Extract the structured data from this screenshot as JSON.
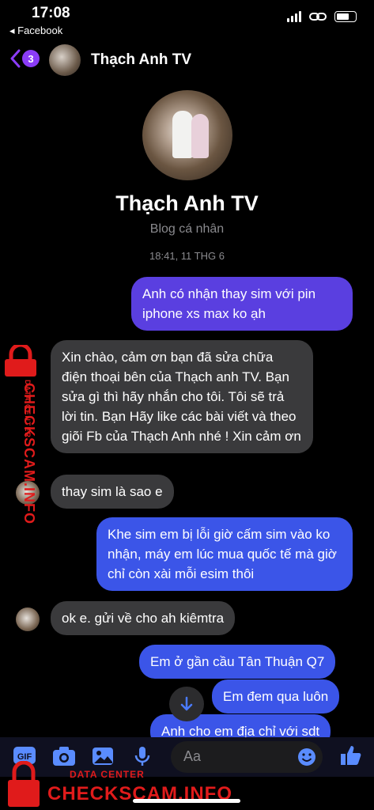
{
  "status": {
    "time": "17:08",
    "back_app": "◂ Facebook"
  },
  "header": {
    "badge": "3",
    "name": "Thạch Anh TV"
  },
  "profile": {
    "name": "Thạch Anh TV",
    "subtitle": "Blog cá nhân",
    "timestamp": "18:41, 11 THG 6"
  },
  "messages": [
    {
      "side": "out",
      "text": "Anh có nhận thay sim với pin iphone xs max ko ạh"
    },
    {
      "side": "in",
      "text": "Xin chào, cảm ơn bạn đã sửa chữa điện thoại bên của Thạch anh TV. Bạn sửa gì thì hãy nhắn cho tôi. Tôi sẽ trả lời tin. Bạn Hãy like các bài viết và theo giõi Fb của Thạch Anh nhé ! Xin cảm ơn"
    },
    {
      "side": "in",
      "text": "thay sim là sao e"
    },
    {
      "side": "out",
      "text": "Khe sim em bị lỗi giờ cấm sim vào ko nhận, máy em lúc mua quốc tế mà giờ chỉ còn xài mỗi esim thôi"
    },
    {
      "side": "in",
      "text": "ok e. gửi về cho ah kiêmtra"
    },
    {
      "side": "out",
      "text": "Em ở gần cầu Tân Thuận Q7"
    },
    {
      "side": "out",
      "text": "Em đem qua luôn"
    },
    {
      "side": "out",
      "text": "Anh cho em địa chỉ với sdt"
    }
  ],
  "composer": {
    "placeholder": "Aa"
  },
  "watermark": {
    "brand": "CHECKSCAM.INFO",
    "tag": "DATA CENTER"
  },
  "colors": {
    "outgoing": "#5a3fe0",
    "outgoing_blue": "#3b55e8",
    "incoming": "#3a3a3c",
    "accent": "#8b3cf7",
    "watermark": "#e01b1b"
  }
}
